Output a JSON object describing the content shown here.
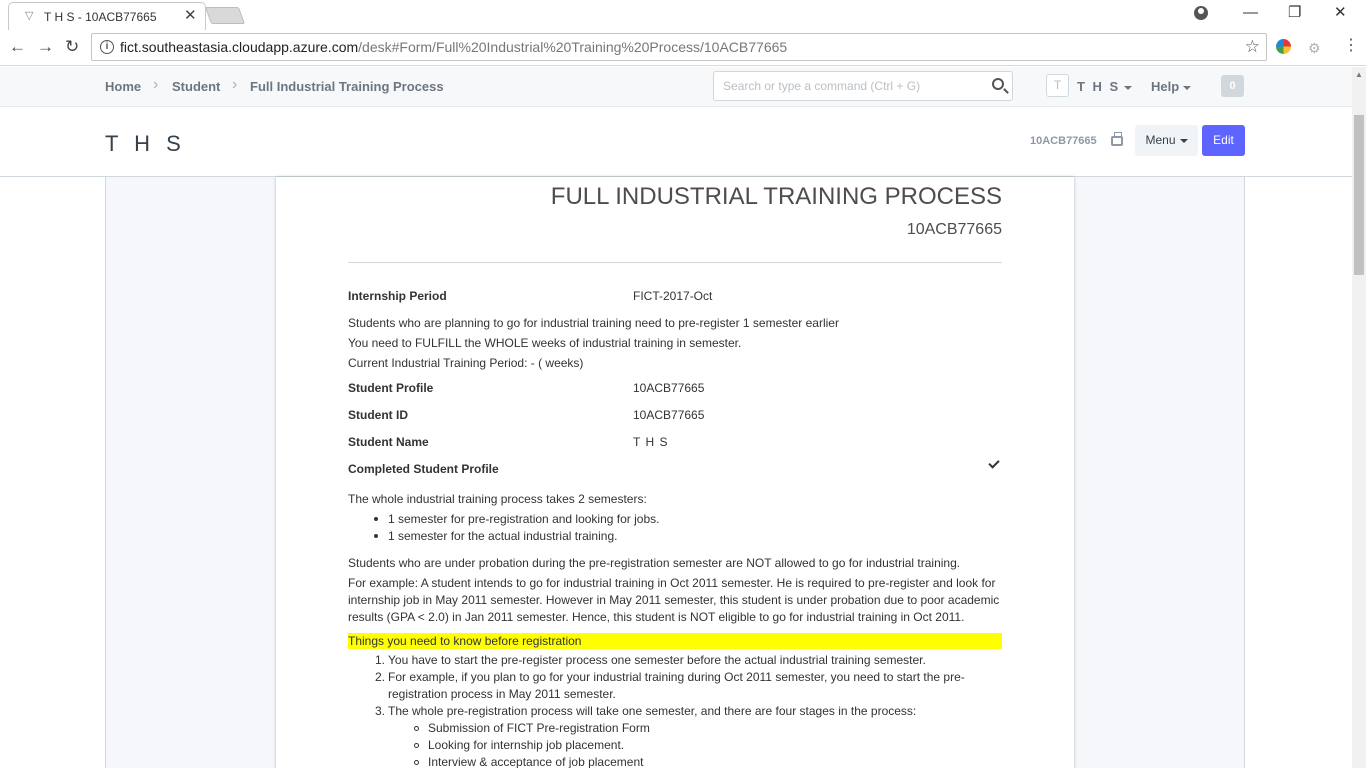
{
  "browser": {
    "tab_title": "T H S - 10ACB77665",
    "url_host": "fict.southeastasia.cloudapp.azure.com",
    "url_path": "/desk#Form/Full%20Industrial%20Training%20Process/10ACB77665"
  },
  "navbar": {
    "breadcrumbs": [
      "Home",
      "Student",
      "Full Industrial Training Process"
    ],
    "search_placeholder": "Search or type a command (Ctrl + G)",
    "avatar_initial": "T",
    "user_label": "T H S",
    "help_label": "Help",
    "notification_count": "0"
  },
  "page_head": {
    "title": "T H S",
    "doc_id": "10ACB77665",
    "menu_label": "Menu",
    "edit_label": "Edit"
  },
  "document": {
    "heading": "FULL INDUSTRIAL TRAINING PROCESS",
    "subheading": "10ACB77665",
    "fields": [
      {
        "label": "Internship Period",
        "value": "FICT-2017-Oct"
      },
      {
        "label": "Student Profile",
        "value": "10ACB77665"
      },
      {
        "label": "Student ID",
        "value": "10ACB77665"
      },
      {
        "label": "Student Name",
        "value": "T H S"
      },
      {
        "label": "Completed Student Profile",
        "value": ""
      }
    ],
    "notes": [
      "Students who are planning to go for industrial training need to pre-register 1 semester earlier",
      "You need to FULFILL the WHOLE weeks of industrial training in semester.",
      "Current Industrial Training Period: - ( weeks)"
    ],
    "process_intro": "The whole industrial training process takes 2 semesters:",
    "process_items": [
      "1 semester for pre-registration and looking for jobs.",
      "1 semester for the actual industrial training."
    ],
    "probation_text": "Students who are under probation during the pre-registration semester are NOT allowed to go for industrial training.",
    "example_lines": [
      "For example: A student intends to go for industrial training in Oct 2011 semester. He is required to pre-register and look for",
      "internship job in May 2011 semester. However in May 2011 semester, this student is under probation due to poor academic",
      "results (GPA < 2.0) in Jan 2011 semester. Hence, this student is NOT eligible to go for industrial training in Oct 2011."
    ],
    "highlight_title": "Things you need to know before registration",
    "steps": [
      {
        "num": "1.",
        "lines": [
          "You have to start the pre-register process one semester before the actual industrial training semester."
        ]
      },
      {
        "num": "2.",
        "lines": [
          "For example, if you plan to go for your industrial training during Oct 2011 semester, you need to start the pre-",
          "registration process in May 2011 semester."
        ]
      },
      {
        "num": "3.",
        "lines": [
          "The whole pre-registration process will take one semester, and there are four stages in the process:"
        ]
      }
    ],
    "stages": [
      "Submission of FICT Pre-registration Form",
      "Looking for internship job placement.",
      "Interview & acceptance of job placement"
    ]
  }
}
